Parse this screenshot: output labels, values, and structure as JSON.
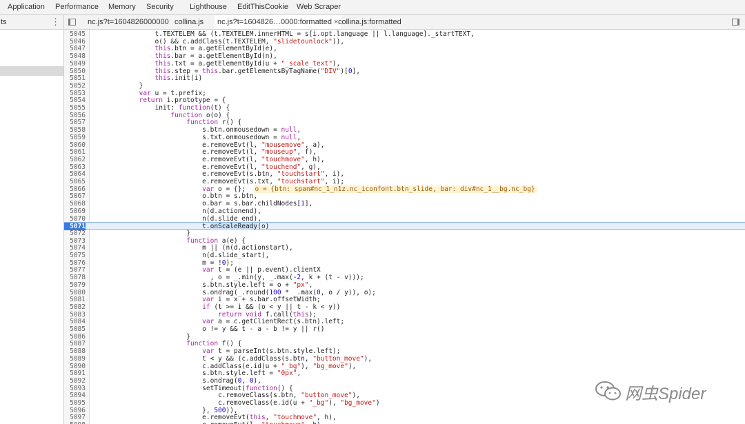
{
  "panel_tabs": [
    "Application",
    "Performance",
    "Memory",
    "Security",
    "Lighthouse",
    "EditThisCookie",
    "Web Scraper"
  ],
  "navigator": {
    "label": "ts"
  },
  "file_tabs": [
    {
      "label": "nc.js?t=1604826000000",
      "closable": false,
      "active": false
    },
    {
      "label": "collina.js",
      "closable": false,
      "active": false
    },
    {
      "label": "nc.js?t=1604826…0000:formatted",
      "closable": true,
      "active": true
    },
    {
      "label": "collina.js:formatted",
      "closable": false,
      "active": false
    }
  ],
  "code": {
    "current_line": 5071,
    "lines": [
      {
        "n": 5045,
        "t": "                t.TEXTELEM && (t.TEXTELEM.innerHTML = s[i.opt.language || l.language]._startTEXT,"
      },
      {
        "n": 5046,
        "t": "                o() && c.addClass(t.TEXTELEM, \"slidetounlock\")),"
      },
      {
        "n": 5047,
        "t": "                this.btn = a.getElementById(e),"
      },
      {
        "n": 5048,
        "t": "                this.bar = a.getElementById(n),"
      },
      {
        "n": 5049,
        "t": "                this.txt = a.getElementById(u + \"_scale_text\"),"
      },
      {
        "n": 5050,
        "t": "                this.step = this.bar.getElementsByTagName(\"DIV\")[0],"
      },
      {
        "n": 5051,
        "t": "                this.init(i)"
      },
      {
        "n": 5052,
        "t": "            }"
      },
      {
        "n": 5053,
        "t": "            var u = t.prefix;"
      },
      {
        "n": 5054,
        "t": "            return i.prototype = {"
      },
      {
        "n": 5055,
        "t": "                init: function(t) {"
      },
      {
        "n": 5056,
        "t": "                    function o(o) {"
      },
      {
        "n": 5057,
        "t": "                        function r() {"
      },
      {
        "n": 5058,
        "t": "                            s.btn.onmousedown = null,"
      },
      {
        "n": 5059,
        "t": "                            s.txt.onmousedown = null,"
      },
      {
        "n": 5060,
        "t": "                            e.removeEvt(l, \"mousemove\", a),"
      },
      {
        "n": 5061,
        "t": "                            e.removeEvt(l, \"mouseup\", f),"
      },
      {
        "n": 5062,
        "t": "                            e.removeEvt(l, \"touchmove\", h),"
      },
      {
        "n": 5063,
        "t": "                            e.removeEvt(l, \"touchend\", g),"
      },
      {
        "n": 5064,
        "t": "                            e.removeEvt(s.btn, \"touchstart\", i),"
      },
      {
        "n": 5065,
        "t": "                            e.removeEvt(s.txt, \"touchstart\", i);"
      },
      {
        "n": 5066,
        "t": "                            var o = {};",
        "inline": "o = {btn: span#nc_1_n1z.nc_iconfont.btn_slide, bar: div#nc_1__bg.nc_bg}"
      },
      {
        "n": 5067,
        "t": "                            o.btn = s.btn,"
      },
      {
        "n": 5068,
        "t": "                            o.bar = s.bar.childNodes[1],"
      },
      {
        "n": 5069,
        "t": "                            n(d.actionend),"
      },
      {
        "n": 5070,
        "t": "                            n(d.slide_end),"
      },
      {
        "n": 5071,
        "t": "                            t.onScaleReady(o)"
      },
      {
        "n": 5072,
        "t": "                        }"
      },
      {
        "n": 5073,
        "t": "                        function a(e) {"
      },
      {
        "n": 5074,
        "t": "                            m || (n(d.actionstart),"
      },
      {
        "n": 5075,
        "t": "                            n(d.slide_start),"
      },
      {
        "n": 5076,
        "t": "                            m = !0);"
      },
      {
        "n": 5077,
        "t": "                            var t = (e || p.event).clientX"
      },
      {
        "n": 5078,
        "t": "                              , o = _.min(y, _.max(-2, k + (t - v)));"
      },
      {
        "n": 5079,
        "t": "                            s.btn.style.left = o + \"px\","
      },
      {
        "n": 5080,
        "t": "                            s.ondrag(_.round(100 * _.max(0, o / y)), o);"
      },
      {
        "n": 5081,
        "t": "                            var i = x + s.bar.offsetWidth;"
      },
      {
        "n": 5082,
        "t": "                            if (t >= i && (o < y || t - k < y))"
      },
      {
        "n": 5083,
        "t": "                                return void f.call(this);"
      },
      {
        "n": 5084,
        "t": "                            var a = c.getClientRect(s.btn).left;"
      },
      {
        "n": 5085,
        "t": "                            o != y && t - a - b != y || r()"
      },
      {
        "n": 5086,
        "t": "                        }"
      },
      {
        "n": 5087,
        "t": "                        function f() {"
      },
      {
        "n": 5088,
        "t": "                            var t = parseInt(s.btn.style.left);"
      },
      {
        "n": 5089,
        "t": "                            t < y && (c.addClass(s.btn, \"button_move\"),"
      },
      {
        "n": 5090,
        "t": "                            c.addClass(e.id(u + \"_bg\"), \"bg_move\"),"
      },
      {
        "n": 5091,
        "t": "                            s.btn.style.left = \"0px\","
      },
      {
        "n": 5092,
        "t": "                            s.ondrag(0, 0),"
      },
      {
        "n": 5093,
        "t": "                            setTimeout(function() {"
      },
      {
        "n": 5094,
        "t": "                                c.removeClass(s.btn, \"button_move\"),"
      },
      {
        "n": 5095,
        "t": "                                c.removeClass(e.id(u + \"_bg\"), \"bg_move\")"
      },
      {
        "n": 5096,
        "t": "                            }, 500)),"
      },
      {
        "n": 5097,
        "t": "                            e.removeEvt(this, \"touchmove\", h),"
      },
      {
        "n": 5098,
        "t": "                            e.removeEvt(l, \"touchmove\", h),"
      }
    ]
  },
  "watermark": {
    "text": "网虫Spider",
    "icon": "wechat-icon"
  }
}
